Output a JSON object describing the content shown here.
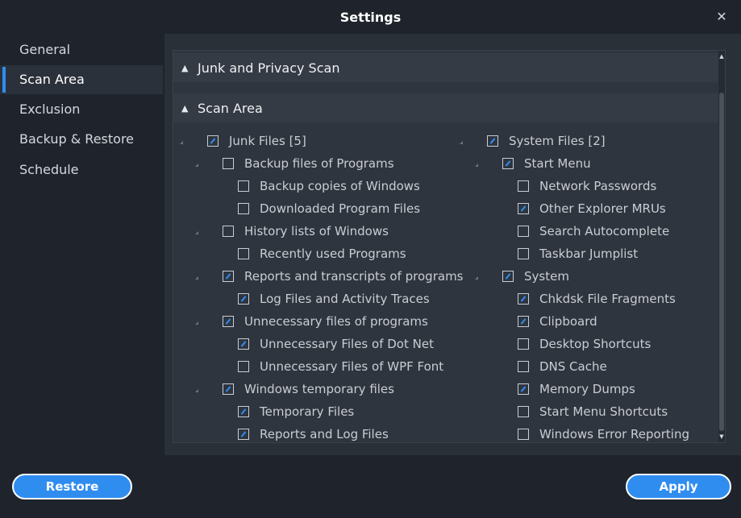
{
  "window": {
    "title": "Settings"
  },
  "sidebar": {
    "items": [
      {
        "label": "General"
      },
      {
        "label": "Scan Area",
        "active": true
      },
      {
        "label": "Exclusion"
      },
      {
        "label": "Backup & Restore"
      },
      {
        "label": "Schedule"
      }
    ]
  },
  "sections": {
    "junk_privacy": {
      "label": "Junk and Privacy Scan"
    },
    "scan_area": {
      "label": "Scan Area"
    }
  },
  "left_tree": [
    {
      "label": "Junk Files [5]",
      "checked": true
    },
    {
      "label": "Backup files of Programs",
      "checked": false
    },
    {
      "label": "Backup copies of Windows",
      "checked": false
    },
    {
      "label": "Downloaded Program Files",
      "checked": false
    },
    {
      "label": "History lists of Windows",
      "checked": false
    },
    {
      "label": "Recently used Programs",
      "checked": false
    },
    {
      "label": "Reports and transcripts of programs",
      "checked": true
    },
    {
      "label": "Log Files and Activity Traces",
      "checked": true
    },
    {
      "label": "Unnecessary files of programs",
      "checked": true
    },
    {
      "label": "Unnecessary Files of Dot Net",
      "checked": true
    },
    {
      "label": "Unnecessary Files of WPF Font",
      "checked": false
    },
    {
      "label": "Windows temporary files",
      "checked": true
    },
    {
      "label": "Temporary Files",
      "checked": true
    },
    {
      "label": "Reports and Log Files",
      "checked": true
    }
  ],
  "right_tree": [
    {
      "label": "System Files [2]",
      "checked": true
    },
    {
      "label": "Start Menu",
      "checked": true
    },
    {
      "label": "Network Passwords",
      "checked": false
    },
    {
      "label": "Other Explorer MRUs",
      "checked": true
    },
    {
      "label": "Search Autocomplete",
      "checked": false
    },
    {
      "label": "Taskbar Jumplist",
      "checked": false
    },
    {
      "label": "System",
      "checked": true
    },
    {
      "label": "Chkdsk File Fragments",
      "checked": true
    },
    {
      "label": "Clipboard",
      "checked": true
    },
    {
      "label": "Desktop Shortcuts",
      "checked": false
    },
    {
      "label": "DNS Cache",
      "checked": false
    },
    {
      "label": "Memory Dumps",
      "checked": true
    },
    {
      "label": "Start Menu Shortcuts",
      "checked": false
    },
    {
      "label": "Windows Error Reporting",
      "checked": false
    }
  ],
  "buttons": {
    "restore": "Restore",
    "apply": "Apply"
  },
  "colors": {
    "accent": "#2f8df0",
    "background": "#1f242c",
    "panel": "#2a3038"
  }
}
